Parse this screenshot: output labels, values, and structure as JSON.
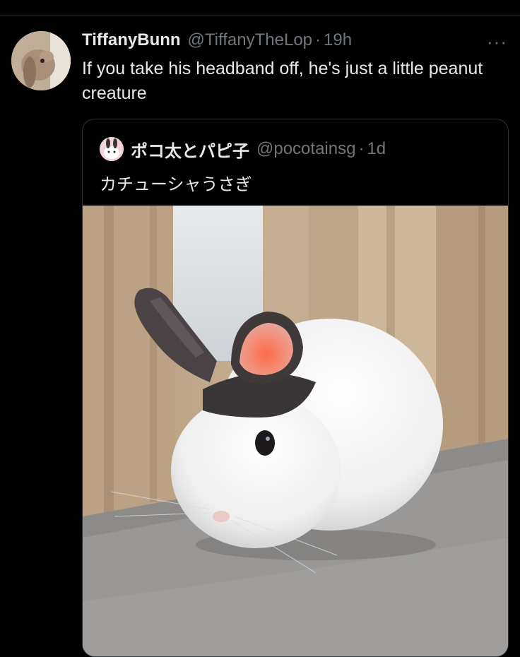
{
  "tweet": {
    "display_name": "TiffanyBunn",
    "handle": "@TiffanyTheLop",
    "separator": "·",
    "time": "19h",
    "more_icon": "···",
    "text": "If you take his headband off, he's just a little peanut creature"
  },
  "quoted_tweet": {
    "display_name": "ポコ太とパピ子",
    "handle": "@pocotainsg",
    "separator": "·",
    "time": "1d",
    "text": "カチューシャうさぎ"
  },
  "colors": {
    "background": "#000000",
    "text_primary": "#e7e9ea",
    "text_secondary": "#71767b",
    "border": "#2f3336"
  }
}
